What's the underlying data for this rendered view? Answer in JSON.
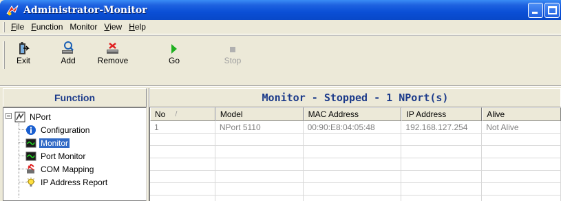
{
  "window": {
    "title": "Administrator-Monitor"
  },
  "menu": {
    "items": [
      {
        "label": "File",
        "accel": "F",
        "rest": "ile"
      },
      {
        "label": "Function",
        "accel": "F",
        "rest": "unction"
      },
      {
        "label": "Monitor",
        "accel": "",
        "rest": "Monitor"
      },
      {
        "label": "View",
        "accel": "V",
        "rest": "iew"
      },
      {
        "label": "Help",
        "accel": "H",
        "rest": "elp"
      }
    ]
  },
  "toolbar": {
    "exit_label": "Exit",
    "add_label": "Add",
    "remove_label": "Remove",
    "go_label": "Go",
    "stop_label": "Stop"
  },
  "function_pane": {
    "header": "Function",
    "tree": {
      "root": "NPort",
      "children": [
        {
          "label": "Configuration",
          "icon": "info-icon"
        },
        {
          "label": "Monitor",
          "icon": "monitor-icon",
          "selected": true
        },
        {
          "label": "Port Monitor",
          "icon": "port-monitor-icon"
        },
        {
          "label": "COM Mapping",
          "icon": "com-mapping-icon"
        },
        {
          "label": "IP Address Report",
          "icon": "bulb-icon"
        }
      ]
    }
  },
  "monitor_pane": {
    "header": "Monitor - Stopped - 1 NPort(s)",
    "columns": [
      "No",
      "Model",
      "MAC Address",
      "IP Address",
      "Alive"
    ],
    "sort_glyph": "/",
    "rows": [
      {
        "no": "1",
        "model": "NPort 5110",
        "mac": "00:90:E8:04:05:48",
        "ip": "192.168.127.254",
        "alive": "Not Alive"
      }
    ],
    "empty_rows": 6
  },
  "colors": {
    "title_bar": "#0a4fd6",
    "header_text": "#1b3a8a",
    "selection": "#316ac5"
  }
}
